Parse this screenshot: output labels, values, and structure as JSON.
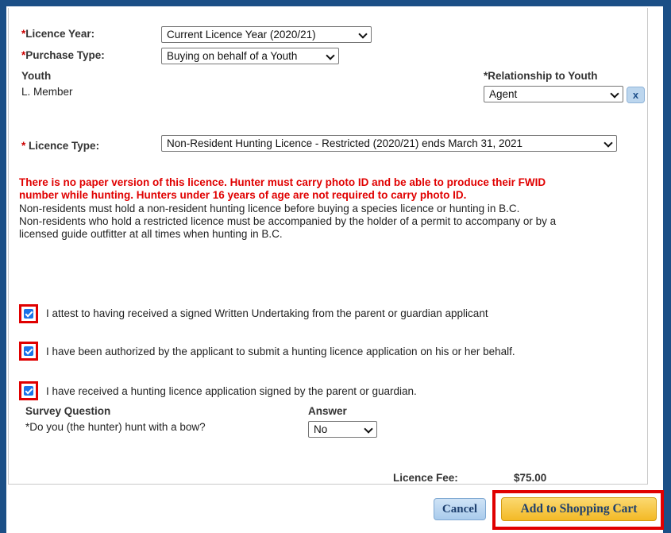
{
  "form": {
    "licence_year": {
      "label": "Licence Year:",
      "value": "Current Licence Year (2020/21)"
    },
    "purchase_type": {
      "label": "Purchase Type:",
      "value": "Buying on behalf of a Youth"
    },
    "youth": {
      "label": "Youth",
      "value": "L. Member"
    },
    "relationship": {
      "label": "Relationship to Youth",
      "value": "Agent",
      "remove_label": "x"
    },
    "licence_type": {
      "label": "Licence Type:",
      "value": "Non-Resident Hunting Licence - Restricted (2020/21) ends March 31, 2021"
    },
    "required_mark": "*"
  },
  "notice": {
    "warning_line1": "There is no paper version of this licence. Hunter must carry photo ID and be able to produce their FWID",
    "warning_line2": "number while hunting. Hunters under 16 years of age are not required to carry photo ID.",
    "info_line1": "Non-residents must hold a non-resident hunting licence before buying a species licence or hunting in B.C.",
    "info_line2": "Non-residents who hold a restricted licence must be accompanied by the holder of a permit to accompany or by a",
    "info_line3": "licensed guide outfitter at all times when hunting in B.C."
  },
  "attestations": [
    {
      "label": "I attest to having received a signed Written Undertaking from the parent or guardian applicant",
      "checked": true
    },
    {
      "label": "I have been authorized by the applicant to submit a hunting licence application on his or her behalf.",
      "checked": true
    },
    {
      "label": "I have received a hunting licence application signed by the parent or guardian.",
      "checked": true
    }
  ],
  "survey": {
    "question_header": "Survey Question",
    "answer_header": "Answer",
    "question": "*Do you (the hunter) hunt with a bow?",
    "answer": "No"
  },
  "fee": {
    "label": "Licence Fee:",
    "value": "$75.00"
  },
  "actions": {
    "cancel_label": "Cancel",
    "add_label": "Add to Shopping Cart"
  },
  "colors": {
    "background": "#1b4f86",
    "warning": "#e00000",
    "primary_button": "#f3b926",
    "secondary_button": "#bcd6ee"
  }
}
